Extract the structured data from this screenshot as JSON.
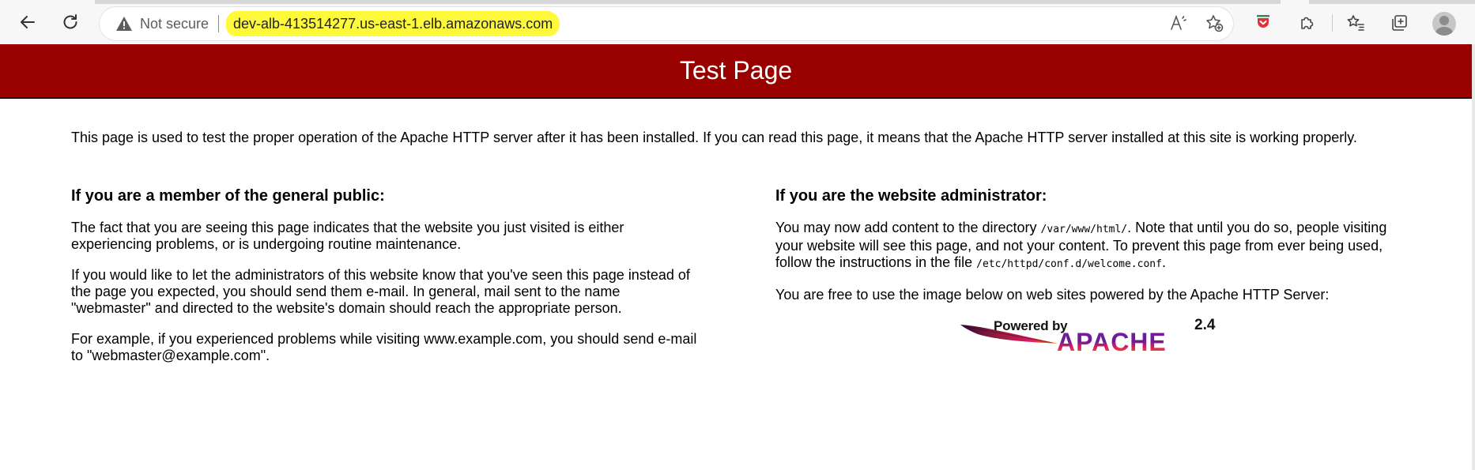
{
  "browser": {
    "security_label": "Not secure",
    "url": "dev-alb-413514277.us-east-1.elb.amazonaws.com",
    "icons": [
      "back-arrow-icon",
      "refresh-icon",
      "warning-triangle-icon",
      "read-aloud-icon",
      "add-favorite-icon",
      "extension-pocket-icon",
      "extensions-puzzle-icon",
      "favorites-icon",
      "collections-icon",
      "profile-avatar-icon"
    ],
    "highlight_color": "#fff93b"
  },
  "page": {
    "title": "Test Page",
    "header_color": "#990000",
    "intro": "This page is used to test the proper operation of the Apache HTTP server after it has been installed. If you can read this page, it means that the Apache HTTP server installed at this site is working properly.",
    "public": {
      "heading": "If you are a member of the general public:",
      "p1": "The fact that you are seeing this page indicates that the website you just visited is either experiencing problems, or is undergoing routine maintenance.",
      "p2": "If you would like to let the administrators of this website know that you've seen this page instead of the page you expected, you should send them e-mail. In general, mail sent to the name \"webmaster\" and directed to the website's domain should reach the appropriate person.",
      "p3": "For example, if you experienced problems while visiting www.example.com, you should send e-mail to \"webmaster@example.com\"."
    },
    "admin": {
      "heading": "If you are the website administrator:",
      "p1_before": "You may now add content to the directory ",
      "p1_path": "/var/www/html/",
      "p1_after": ". Note that until you do so, people visiting your website will see this page, and not your content. To prevent this page from ever being used, follow the instructions in the file ",
      "p1_file": "/etc/httpd/conf.d/welcome.conf",
      "p1_end": ".",
      "p2": "You are free to use the image below on web sites powered by the Apache HTTP Server:"
    },
    "badge": {
      "powered_by": "Powered by",
      "version": "2.4",
      "name": "APACHE"
    }
  }
}
